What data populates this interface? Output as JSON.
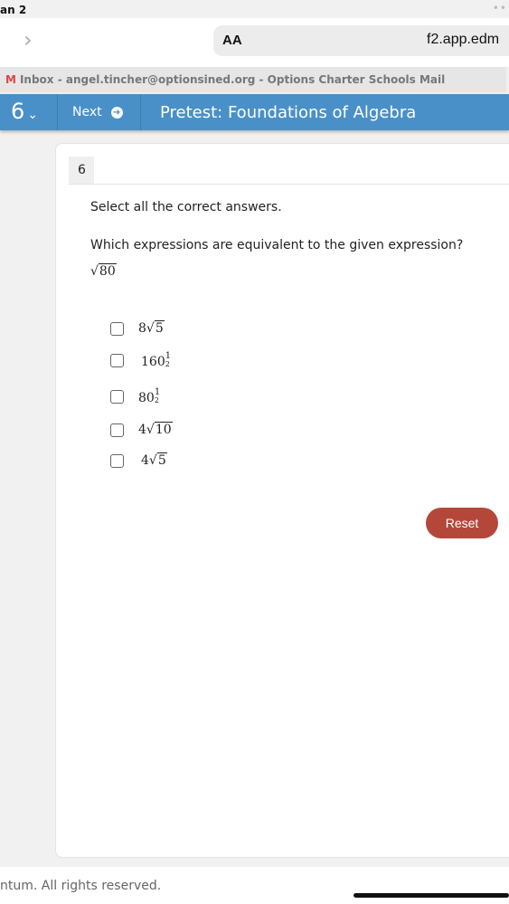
{
  "status": {
    "time": "an 2"
  },
  "browser": {
    "aa_label": "AA",
    "url": "f2.app.edm",
    "tab_title": "Inbox - angel.tincher@optionsined.org - Options Charter Schools Mail",
    "tab_icon": "gmail-icon"
  },
  "nav": {
    "question_number": "6",
    "next_label": "Next",
    "title": "Pretest: Foundations of Algebra",
    "color": "#4a90c8"
  },
  "question": {
    "number": "6",
    "instruction": "Select all the correct answers.",
    "prompt": "Which expressions are equivalent to the given expression?",
    "given": {
      "radicand": "80"
    },
    "options": [
      {
        "coef": "8",
        "radicand": "5"
      },
      {
        "base": "160",
        "num": "1",
        "den": "2"
      },
      {
        "base": "80",
        "num": "1",
        "den": "2"
      },
      {
        "coef": "4",
        "radicand": "10"
      },
      {
        "coef": "4",
        "radicand": "5"
      }
    ]
  },
  "reset_label": "Reset",
  "reset_color": "#b5473a",
  "footer": "ntum. All rights reserved."
}
